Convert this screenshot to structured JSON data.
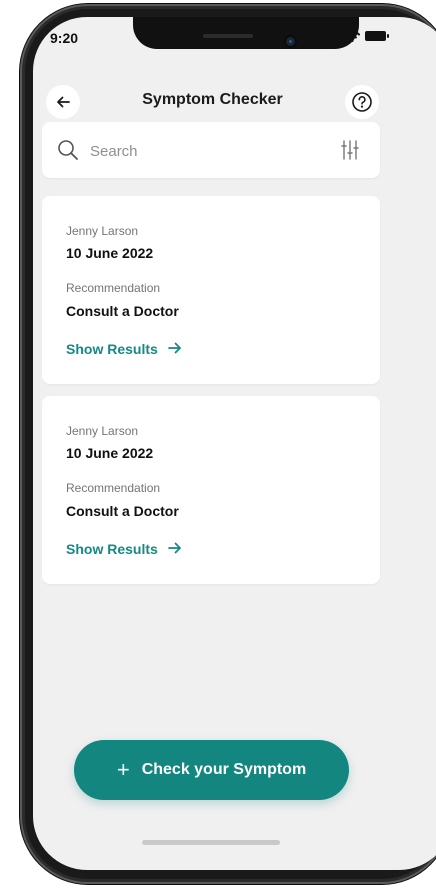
{
  "status_bar": {
    "time": "9:20"
  },
  "nav": {
    "title": "Symptom Checker",
    "back_icon": "arrow-left-icon",
    "help_icon": "question-circle-icon"
  },
  "search": {
    "placeholder": "Search",
    "value": "",
    "icon": "search-icon",
    "filter_icon": "filter-sliders-icon"
  },
  "results": [
    {
      "name": "Jenny Larson",
      "date": "10 June 2022",
      "recommendation_label": "Recommendation",
      "recommendation": "Consult a Doctor",
      "action_label": "Show Results",
      "action_icon": "arrow-right-icon"
    },
    {
      "name": "Jenny Larson",
      "date": "10 June 2022",
      "recommendation_label": "Recommendation",
      "recommendation": "Consult a Doctor",
      "action_label": "Show Results",
      "action_icon": "arrow-right-icon"
    }
  ],
  "cta": {
    "label": "Check your Symptom",
    "icon": "plus-icon"
  },
  "colors": {
    "accent": "#12867f",
    "link": "#138a83",
    "background": "#f1f0f1",
    "card": "#ffffff",
    "text_primary": "#111111",
    "text_secondary": "#757575"
  }
}
